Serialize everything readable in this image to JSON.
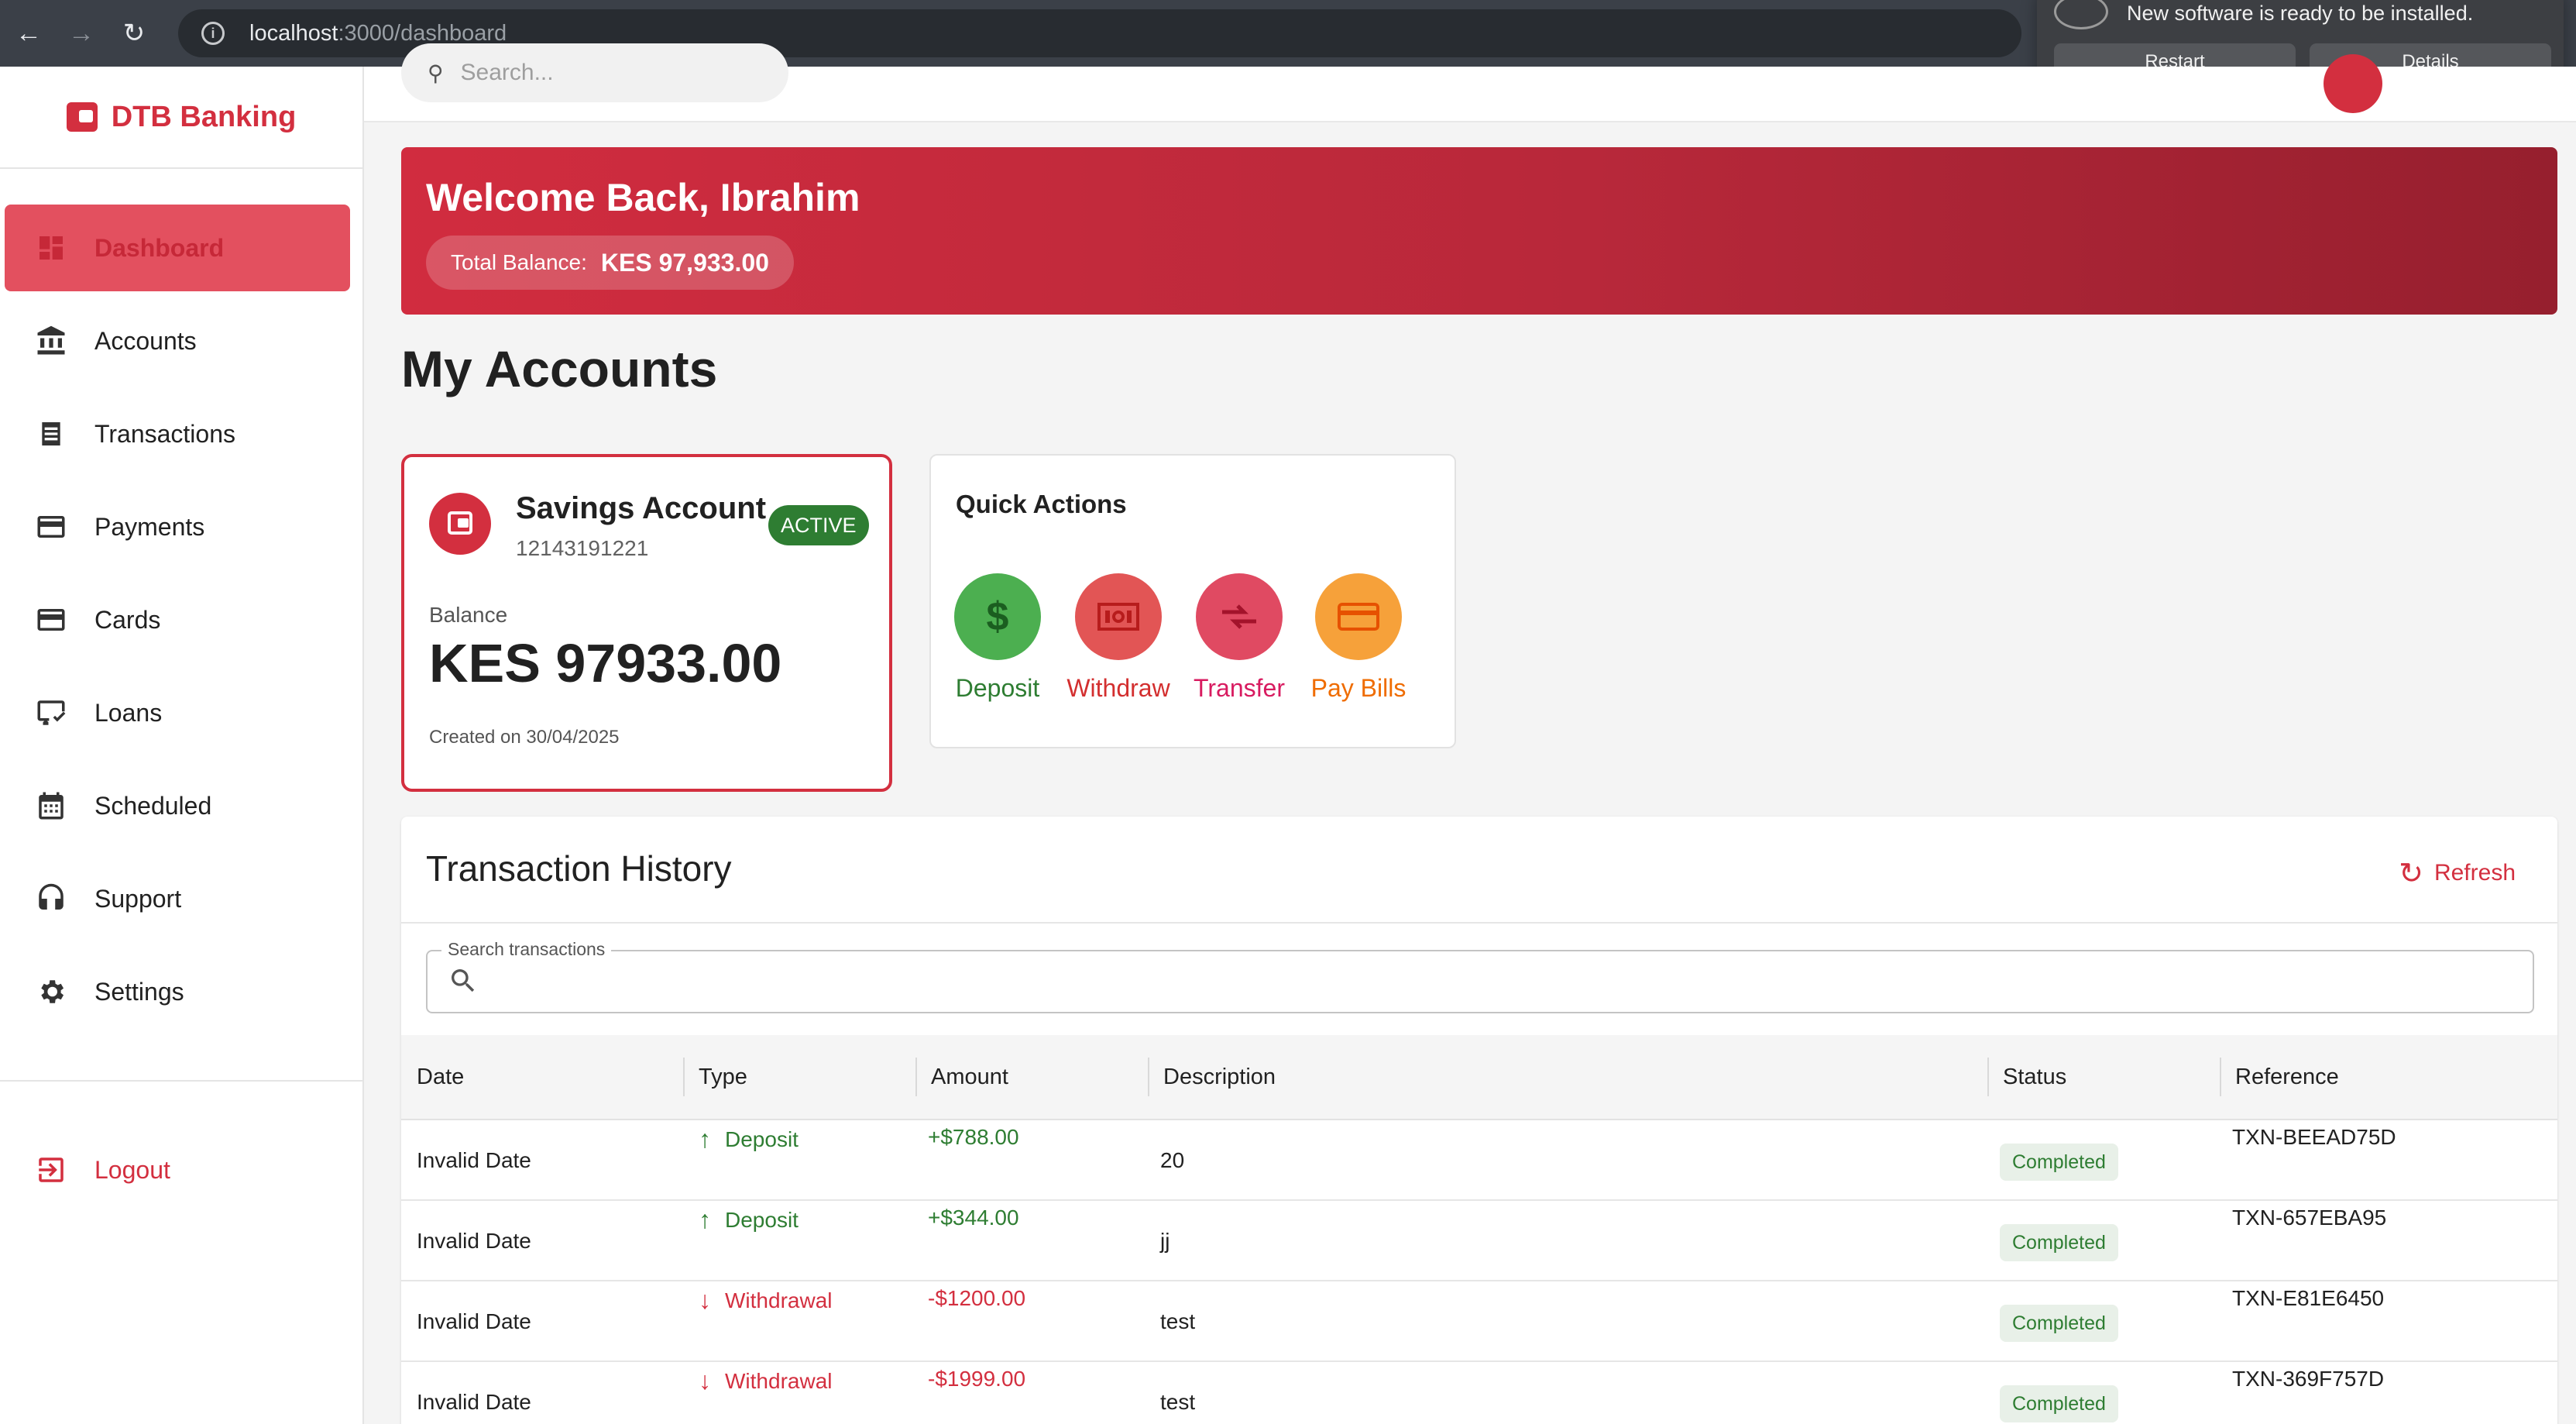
{
  "browser": {
    "url_host": "localhost",
    "url_path": ":3000/dashboard"
  },
  "notification": {
    "message": "New software is ready to be installed.",
    "restart_label": "Restart",
    "details_label": "Details"
  },
  "sidebar": {
    "brand": "DTB Banking",
    "items": [
      {
        "label": "Dashboard",
        "icon": "dashboard-icon",
        "active": true
      },
      {
        "label": "Accounts",
        "icon": "bank-icon"
      },
      {
        "label": "Transactions",
        "icon": "receipt-icon"
      },
      {
        "label": "Payments",
        "icon": "credit-card-icon"
      },
      {
        "label": "Cards",
        "icon": "credit-card-icon"
      },
      {
        "label": "Loans",
        "icon": "checkbook-icon"
      },
      {
        "label": "Scheduled",
        "icon": "calendar-icon"
      },
      {
        "label": "Support",
        "icon": "headset-icon"
      },
      {
        "label": "Settings",
        "icon": "gear-icon"
      }
    ],
    "logout_label": "Logout"
  },
  "topbar": {
    "search_placeholder": "Search..."
  },
  "banner": {
    "welcome": "Welcome Back, Ibrahim",
    "total_balance_label": "Total Balance:",
    "total_balance_value": "KES 97,933.00"
  },
  "section_title": "My Accounts",
  "account": {
    "name": "Savings Account",
    "number": "12143191221",
    "status": "ACTIVE",
    "balance_label": "Balance",
    "balance_value": "KES 97933.00",
    "created": "Created on 30/04/2025"
  },
  "quick_actions": {
    "title": "Quick Actions",
    "actions": [
      {
        "label": "Deposit",
        "icon": "dollar-icon",
        "color": "#43a047"
      },
      {
        "label": "Withdraw",
        "icon": "money-icon",
        "color": "#e53935"
      },
      {
        "label": "Transfer",
        "icon": "transfer-icon",
        "color": "#d81b60"
      },
      {
        "label": "Pay Bills",
        "icon": "bill-card-icon",
        "color": "#fb8c00"
      }
    ]
  },
  "transactions": {
    "title": "Transaction History",
    "refresh_label": "Refresh",
    "search_label": "Search transactions",
    "columns": [
      "Date",
      "Type",
      "Amount",
      "Description",
      "Status",
      "Reference"
    ],
    "rows": [
      {
        "date": "Invalid Date",
        "type": "Deposit",
        "direction": "up",
        "amount": "+$788.00",
        "description": "20",
        "status": "Completed",
        "reference": "TXN-BEEAD75D"
      },
      {
        "date": "Invalid Date",
        "type": "Deposit",
        "direction": "up",
        "amount": "+$344.00",
        "description": "jj",
        "status": "Completed",
        "reference": "TXN-657EBA95"
      },
      {
        "date": "Invalid Date",
        "type": "Withdrawal",
        "direction": "down",
        "amount": "-$1200.00",
        "description": "test",
        "status": "Completed",
        "reference": "TXN-E81E6450"
      },
      {
        "date": "Invalid Date",
        "type": "Withdrawal",
        "direction": "down",
        "amount": "-$1999.00",
        "description": "test",
        "status": "Completed",
        "reference": "TXN-369F757D"
      }
    ]
  },
  "colors": {
    "brand": "#d32f3f",
    "deposit": "#2e7d32",
    "withdrawal": "#d32f3f"
  }
}
